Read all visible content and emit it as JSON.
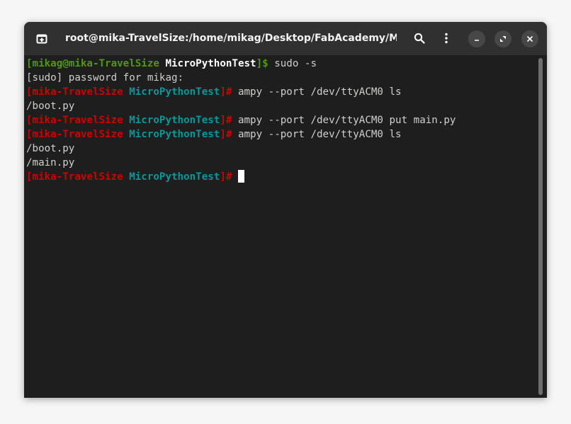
{
  "window": {
    "title": "root@mika-TravelSize:/home/mikag/Desktop/FabAcademy/Mi..."
  },
  "header": {
    "new_tab_icon": "new-tab-icon",
    "search_icon": "search-icon",
    "menu_icon": "kebab-menu-icon",
    "minimize_icon": "minimize-icon",
    "maximize_icon": "maximize-icon",
    "close_icon": "close-icon"
  },
  "colors": {
    "user_prompt": "#4e9a06",
    "root_prompt": "#cc0000",
    "directory": "#06989a",
    "text": "#d0cfcc",
    "background": "#1e1e1e"
  },
  "terminal": {
    "lines": [
      {
        "segments": [
          {
            "text": "[mikag@mika-TravelSize",
            "style": "g"
          },
          {
            "text": " MicroPythonTest",
            "style": "w"
          },
          {
            "text": "]$",
            "style": "g"
          },
          {
            "text": " sudo -s",
            "style": "n"
          }
        ]
      },
      {
        "segments": [
          {
            "text": "[sudo] password for mikag:",
            "style": "n"
          }
        ]
      },
      {
        "segments": [
          {
            "text": "[mika-TravelSize",
            "style": "r"
          },
          {
            "text": " MicroPythonTest",
            "style": "c"
          },
          {
            "text": "]#",
            "style": "r"
          },
          {
            "text": " ampy --port /dev/ttyACM0 ls",
            "style": "n"
          }
        ]
      },
      {
        "segments": [
          {
            "text": "/boot.py",
            "style": "n"
          }
        ]
      },
      {
        "segments": [
          {
            "text": "[mika-TravelSize",
            "style": "r"
          },
          {
            "text": " MicroPythonTest",
            "style": "c"
          },
          {
            "text": "]#",
            "style": "r"
          },
          {
            "text": " ampy --port /dev/ttyACM0 put main.py",
            "style": "n"
          }
        ]
      },
      {
        "segments": [
          {
            "text": "[mika-TravelSize",
            "style": "r"
          },
          {
            "text": " MicroPythonTest",
            "style": "c"
          },
          {
            "text": "]#",
            "style": "r"
          },
          {
            "text": " ampy --port /dev/ttyACM0 ls",
            "style": "n"
          }
        ]
      },
      {
        "segments": [
          {
            "text": "/boot.py",
            "style": "n"
          }
        ]
      },
      {
        "segments": [
          {
            "text": "/main.py",
            "style": "n"
          }
        ]
      },
      {
        "segments": [
          {
            "text": "[mika-TravelSize",
            "style": "r"
          },
          {
            "text": " MicroPythonTest",
            "style": "c"
          },
          {
            "text": "]#",
            "style": "r"
          },
          {
            "text": " ",
            "style": "n"
          }
        ],
        "cursor": true
      }
    ]
  }
}
